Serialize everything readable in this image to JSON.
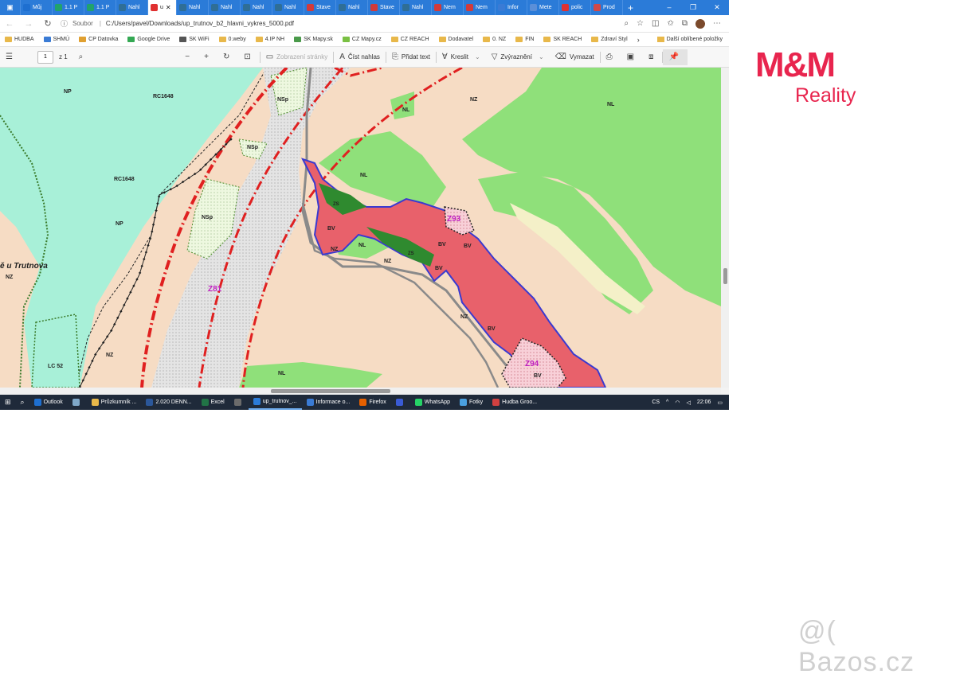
{
  "browser": {
    "tabs": [
      {
        "label": "Můj",
        "color": "#1e6fd0"
      },
      {
        "label": "1.1 P",
        "color": "#21a36b"
      },
      {
        "label": "1.1 P",
        "color": "#21a36b"
      },
      {
        "label": "Nahl",
        "color": "#2f6e96"
      },
      {
        "label": "u",
        "color": "#e03030",
        "active": true
      },
      {
        "label": "Nahl",
        "color": "#2f6e96"
      },
      {
        "label": "Nahl",
        "color": "#2f6e96"
      },
      {
        "label": "Nahl",
        "color": "#2f6e96"
      },
      {
        "label": "Nahl",
        "color": "#2f6e96"
      },
      {
        "label": "Stave",
        "color": "#d23a3a"
      },
      {
        "label": "Nahl",
        "color": "#2f6e96"
      },
      {
        "label": "Stave",
        "color": "#d23a3a"
      },
      {
        "label": "Nahl",
        "color": "#2f6e96"
      },
      {
        "label": "Nem",
        "color": "#d23a3a"
      },
      {
        "label": "Nem",
        "color": "#d23a3a"
      },
      {
        "label": "Infor",
        "color": "#3a7bd5"
      },
      {
        "label": "Mete",
        "color": "#5b8fd8"
      },
      {
        "label": "polic",
        "color": "#e03030"
      },
      {
        "label": "Prod",
        "color": "#d04848"
      }
    ],
    "window_controls": [
      "–",
      "❐",
      "✕"
    ],
    "address": {
      "protocol": "Soubor",
      "url": "C:/Users/pavel/Downloads/up_trutnov_b2_hlavni_vykres_5000.pdf"
    },
    "bookmarks": [
      {
        "label": "HUDBA",
        "type": "folder"
      },
      {
        "label": "SHMÚ",
        "type": "site"
      },
      {
        "label": "CP Datovka",
        "type": "site"
      },
      {
        "label": "Google Drive",
        "type": "site"
      },
      {
        "label": "SK WiFi",
        "type": "site"
      },
      {
        "label": "0.weby",
        "type": "folder"
      },
      {
        "label": "4.IP NH",
        "type": "folder"
      },
      {
        "label": "SK Mapy.sk",
        "type": "site"
      },
      {
        "label": "CZ Mapy.cz",
        "type": "site"
      },
      {
        "label": "CZ REACH",
        "type": "folder"
      },
      {
        "label": "Dodavatel",
        "type": "folder"
      },
      {
        "label": "0. NZ",
        "type": "folder"
      },
      {
        "label": "FIN",
        "type": "folder"
      },
      {
        "label": "SK REACH",
        "type": "folder"
      },
      {
        "label": "Zdraví Styl",
        "type": "folder"
      }
    ],
    "bookmarks_more": "Další oblíbené položky"
  },
  "pdf_toolbar": {
    "page": "1",
    "page_total": "z 1",
    "page_view": "Zobrazení stránky",
    "read_aloud": "Číst nahlas",
    "add_text": "Přidat text",
    "draw": "Kreslit",
    "highlight": "Zvýraznění",
    "erase": "Vymazat"
  },
  "map": {
    "labels": {
      "np1": "NP",
      "np2": "NP",
      "rc1648a": "RC1648",
      "rc1648b": "RC1648",
      "nsp1": "NSp",
      "nsp2": "NSp",
      "nsp3": "NSp",
      "nl1": "NL",
      "nl2": "NL",
      "nl3": "NL",
      "nl4": "NL",
      "nl5": "NL",
      "nz1": "NZ",
      "nz2": "NZ",
      "nz3": "NZ",
      "nz4": "NZ",
      "nz5": "NZ",
      "nz6": "NZ",
      "bv1": "BV",
      "bv2": "BV",
      "bv3": "BV",
      "bv4": "BV",
      "bv5": "BV",
      "bv6": "BV",
      "zs1": "ZS",
      "zs2": "ZS",
      "lc52": "LC 52",
      "place": "ě u Trutnova",
      "z81": "Z81",
      "z93": "Z93",
      "z94": "Z94"
    },
    "colors": {
      "meadow": "#f6dcc4",
      "forest": "#8fe07a",
      "forest_dark": "#6fcf5d",
      "protected": "#a8f0d8",
      "built": "#e8616b",
      "zone_green": "#2f8a2f",
      "railway_corridor": "#dcdcdc",
      "corridor_red": "#e02020"
    }
  },
  "taskbar": {
    "apps": [
      {
        "label": "Outlook",
        "color": "#1e6fd0"
      },
      {
        "label": "",
        "color": "#7fa8c9"
      },
      {
        "label": "Průzkumník ...",
        "color": "#e8b84a"
      },
      {
        "label": "2.020 DENN...",
        "color": "#2b579a"
      },
      {
        "label": "Excel",
        "color": "#217346"
      },
      {
        "label": "",
        "color": "#6b6b6b"
      },
      {
        "label": "up_trutnov_...",
        "color": "#2b7bd8",
        "running": true
      },
      {
        "label": "Informace o...",
        "color": "#3a7bd5"
      },
      {
        "label": "Firefox",
        "color": "#e66000"
      },
      {
        "label": "",
        "color": "#3a5bd5"
      },
      {
        "label": "WhatsApp",
        "color": "#25d366"
      },
      {
        "label": "Fotky",
        "color": "#4aa0e0"
      },
      {
        "label": "Hudba Groo...",
        "color": "#d04040"
      }
    ],
    "lang": "CS",
    "time": "22:06"
  },
  "logo": {
    "mm": "M&M",
    "reality": "Reality",
    "color": "#e8254e"
  },
  "watermark": "@( Bazos.cz"
}
